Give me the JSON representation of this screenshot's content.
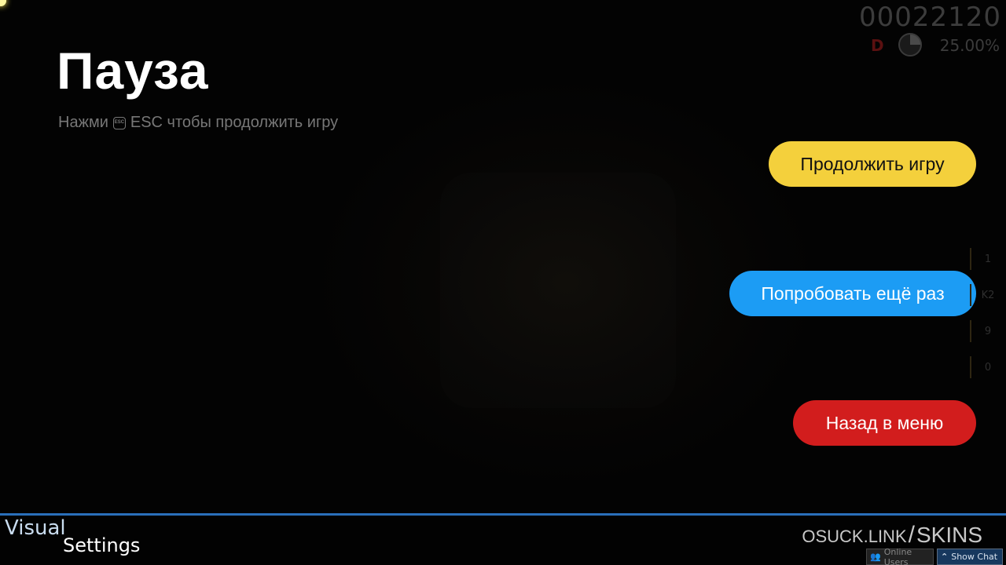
{
  "hud": {
    "score": "00022120",
    "grade": "D",
    "accuracy": "25.00%"
  },
  "pause": {
    "title": "Пауза",
    "subtitle_prefix": "Нажми",
    "esc_key_label": "ESC",
    "subtitle_suffix": "ESC чтобы продолжить игру"
  },
  "buttons": {
    "continue": "Продолжить игру",
    "retry": "Попробовать ещё раз",
    "back_to_menu": "Назад в меню"
  },
  "key_overlay": [
    "1",
    "K2",
    "9",
    "0"
  ],
  "colors": {
    "continue": "#f4d03c",
    "retry": "#1c9cf4",
    "back_to_menu": "#d21d1d",
    "accent_line": "#2a6fba"
  },
  "bottom": {
    "visual": "Visual",
    "settings": "Settings",
    "skin_link_prefix": "OSUCK.LINK",
    "skin_link_slash": "/",
    "skin_link_suffix": "SKINS",
    "online_users": "Online Users",
    "show_chat": "Show Chat"
  },
  "icons": {
    "esc": "esc-key-icon",
    "progress": "progress-pie-icon",
    "users": "users-icon",
    "chevron": "chevron-up-icon"
  }
}
